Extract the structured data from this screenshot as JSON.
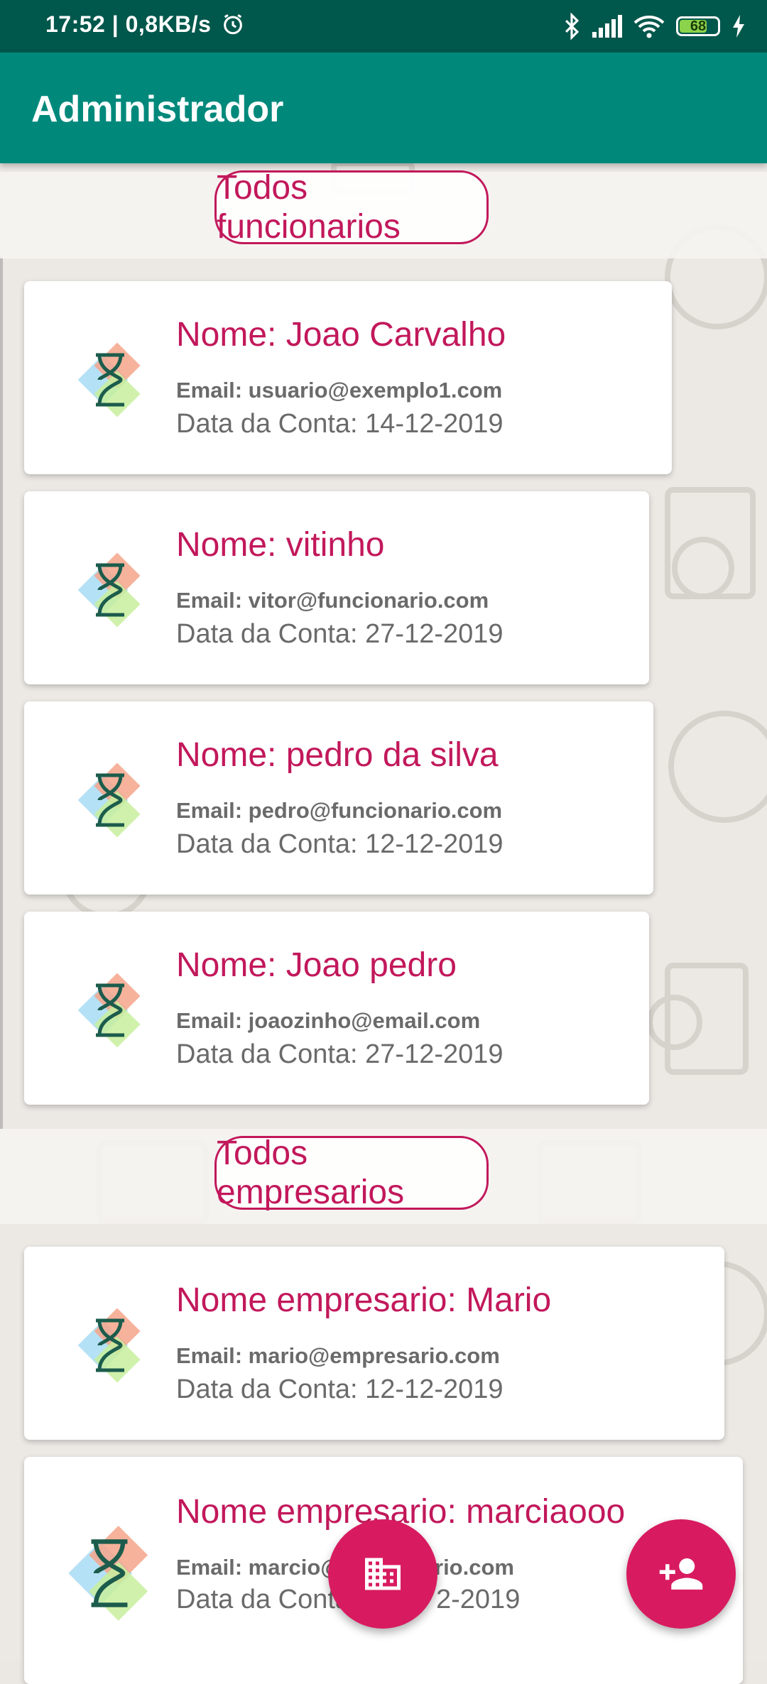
{
  "status_bar": {
    "time_speed": "17:52 | 0,8KB/s",
    "battery": "68",
    "icons": [
      "alarm-icon",
      "bluetooth-icon",
      "signal-icon",
      "wifi-icon",
      "battery-icon",
      "charging-icon"
    ]
  },
  "app_bar": {
    "title": "Administrador"
  },
  "sections": {
    "employees_label": "Todos funcionarios",
    "employers_label": "Todos empresarios"
  },
  "employees": [
    {
      "name": "Nome: Joao Carvalho",
      "email": "Email: usuario@exemplo1.com",
      "date": "Data da Conta: 14-12-2019"
    },
    {
      "name": "Nome: vitinho",
      "email": "Email: vitor@funcionario.com",
      "date": "Data da Conta: 27-12-2019"
    },
    {
      "name": "Nome: pedro da silva",
      "email": "Email: pedro@funcionario.com",
      "date": "Data da Conta: 12-12-2019"
    },
    {
      "name": "Nome: Joao pedro",
      "email": "Email: joaozinho@email.com",
      "date": "Data da Conta: 27-12-2019"
    }
  ],
  "employers": [
    {
      "name": "Nome empresario: Mario",
      "email": "Email: mario@empresario.com",
      "date": "Data da Conta: 12-12-2019"
    },
    {
      "name": "Nome empresario: marciaooo",
      "email": "Email: marcio@",
      "email_tail": "rio.com",
      "date": "Data da Conta",
      "date_tail": "2-2019"
    }
  ],
  "fabs": {
    "company_icon": "business-icon",
    "add_user_icon": "person-add-icon"
  },
  "colors": {
    "status_bar": "#00574b",
    "app_bar": "#00897b",
    "accent": "#c2185b",
    "fab": "#d81b60"
  }
}
